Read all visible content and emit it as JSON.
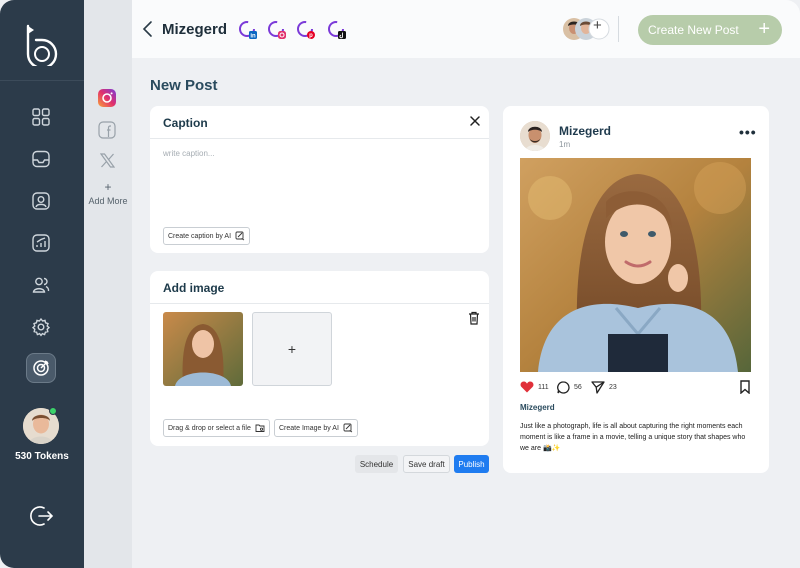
{
  "sidebar": {
    "tokens_label": "530 Tokens",
    "nav_icons": [
      "grid-icon",
      "inbox-icon",
      "contact-icon",
      "analytics-icon",
      "users-icon",
      "settings-icon",
      "target-icon"
    ],
    "active_icon": "target-icon"
  },
  "social_accounts": {
    "icons": [
      "instagram-icon",
      "facebook-icon",
      "x-icon"
    ],
    "add_more_plus": "+",
    "add_more_label": "Add More"
  },
  "header": {
    "account_name": "Mizegerd",
    "team_add": "+",
    "create_button_label": "Create New Post",
    "create_button_plus": "+",
    "platforms": [
      "linkedin",
      "instagram",
      "pinterest",
      "tiktok"
    ]
  },
  "page": {
    "title": "New Post"
  },
  "caption_card": {
    "title": "Caption",
    "placeholder": "write caption...",
    "ai_button_label": "Create caption by AI"
  },
  "image_card": {
    "title": "Add image",
    "add_plus": "+",
    "upload_button_label": "Drag & drop or select a file",
    "ai_button_label": "Create Image by AI"
  },
  "actions": {
    "schedule": "Schedule",
    "save_draft": "Save draft",
    "publish": "Publish"
  },
  "preview": {
    "name": "Mizegerd",
    "time": "1m",
    "more": "•••",
    "likes": "111",
    "comments": "56",
    "shares": "23",
    "username": "Mizegerd",
    "text": "Just like a photograph, life is all about capturing the right moments each moment is like a frame in a movie, telling a unique story that shapes who we are 📸✨"
  },
  "colors": {
    "rail": "#2c3b4a",
    "accent_green": "#b7ccaa",
    "publish_blue": "#1f7cf0",
    "like_red": "#e0303a"
  }
}
